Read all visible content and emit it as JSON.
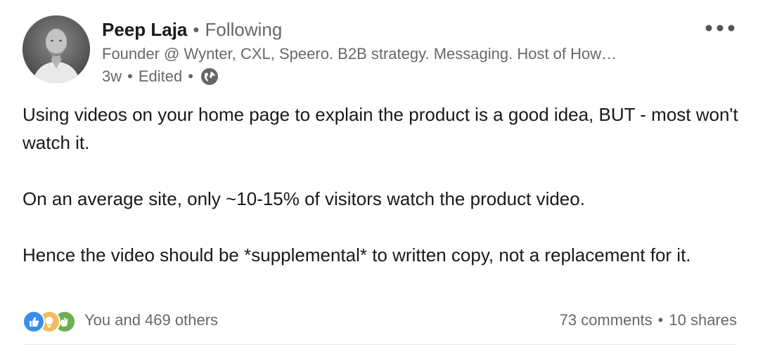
{
  "author": {
    "name": "Peep Laja",
    "connection_status": "Following",
    "headline": "Founder @ Wynter, CXL, Speero. B2B strategy. Messaging. Host of How…",
    "post_age": "3w",
    "edited_label": "Edited",
    "visibility_icon": "globe-icon",
    "separator": "•"
  },
  "post": {
    "paragraphs": [
      "Using videos on your home page to explain the product is a good idea, BUT - most won't watch it.",
      "On an average site, only ~10-15% of visitors watch the product video.",
      "Hence the video should be *supplemental* to written copy, not a replacement for it."
    ]
  },
  "social": {
    "reaction_icons": [
      "like-icon",
      "insightful-icon",
      "celebrate-icon"
    ],
    "reactions_text": "You and 469 others",
    "comments_text": "73 comments",
    "shares_text": "10 shares",
    "separator": "•"
  },
  "menu": {
    "icon": "more-options-icon"
  },
  "colors": {
    "like": "#378fe9",
    "insightful": "#f5bb5c",
    "celebrate": "#6dae4f",
    "primary_text": "#1a1a1a",
    "secondary_text": "#666666"
  }
}
